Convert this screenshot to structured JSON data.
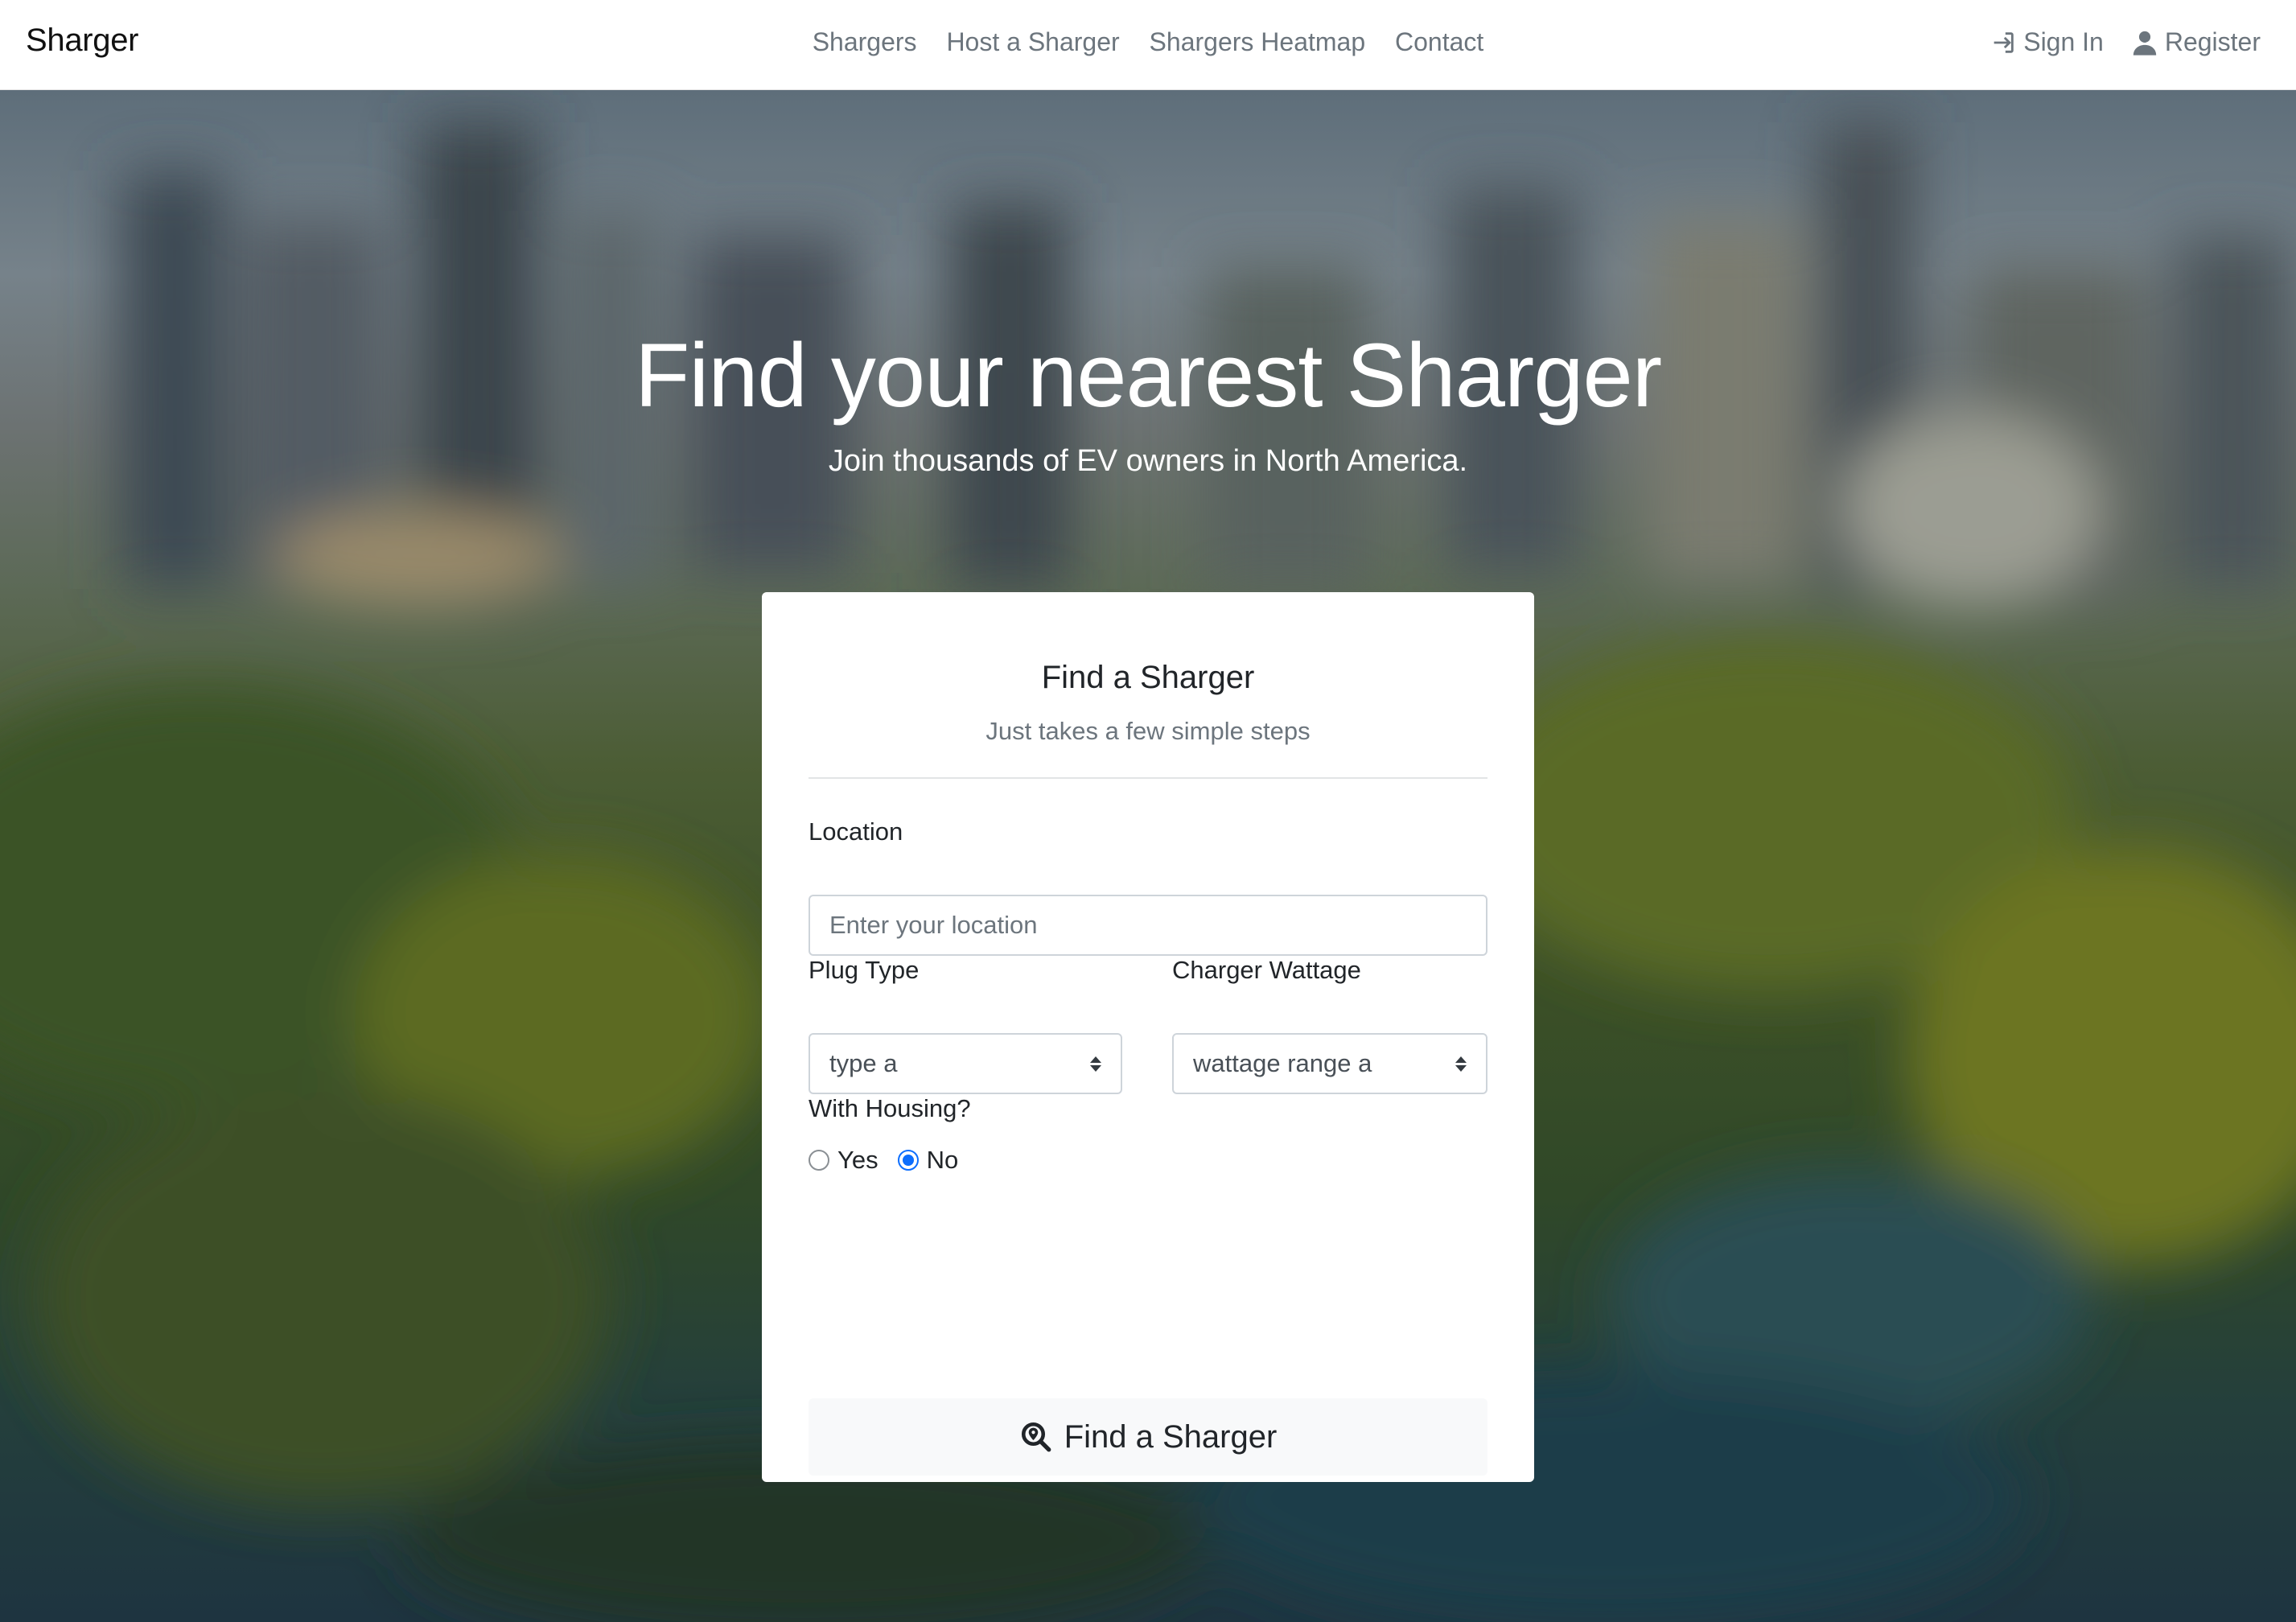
{
  "nav": {
    "brand": "Sharger",
    "links": [
      "Shargers",
      "Host a Sharger",
      "Shargers Heatmap",
      "Contact"
    ],
    "sign_in": "Sign In",
    "register": "Register"
  },
  "hero": {
    "title": "Find your nearest Sharger",
    "subtitle": "Join thousands of EV owners in North America."
  },
  "card": {
    "title": "Find a Sharger",
    "subtitle": "Just takes a few simple steps",
    "location_label": "Location",
    "location_placeholder": "Enter your location",
    "location_value": "",
    "plug_type_label": "Plug Type",
    "plug_type_value": "type a",
    "wattage_label": "Charger Wattage",
    "wattage_value": "wattage range a",
    "housing_label": "With Housing?",
    "housing_options": [
      "Yes",
      "No"
    ],
    "housing_selected": "No",
    "submit_label": "Find a Sharger"
  },
  "colors": {
    "accent": "#0d6efd",
    "nav_text": "#6c757d",
    "button_bg": "#f8f9fa"
  }
}
